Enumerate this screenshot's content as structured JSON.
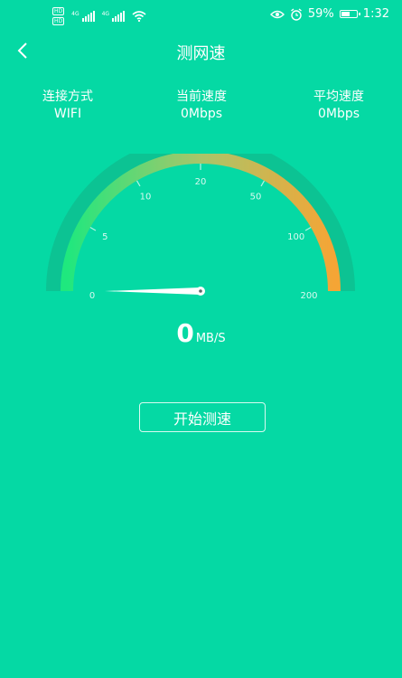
{
  "status_bar": {
    "hd_labels": [
      "HD",
      "HD"
    ],
    "network_labels": [
      "4G",
      "4G"
    ],
    "battery_percent": "59%",
    "battery_level": 0.59,
    "time": "1:32",
    "icons": [
      "eye-icon",
      "alarm-icon",
      "battery-icon",
      "wifi-icon",
      "signal-icon"
    ]
  },
  "header": {
    "title": "测网速",
    "back_icon": "chevron-left-icon"
  },
  "stats": {
    "connection_label": "连接方式",
    "connection_value": "WIFI",
    "current_label": "当前速度",
    "current_value": "0Mbps",
    "average_label": "平均速度",
    "average_value": "0Mbps"
  },
  "gauge": {
    "ticks": [
      "0",
      "5",
      "10",
      "20",
      "50",
      "100",
      "200"
    ],
    "value": 0,
    "colors": {
      "start": "#1fe87e",
      "mid": "#a9c56a",
      "end": "#f5a535",
      "track": "#0cc393"
    }
  },
  "speed": {
    "value": "0",
    "unit": "MB/S"
  },
  "start_button": {
    "label": "开始测速"
  }
}
